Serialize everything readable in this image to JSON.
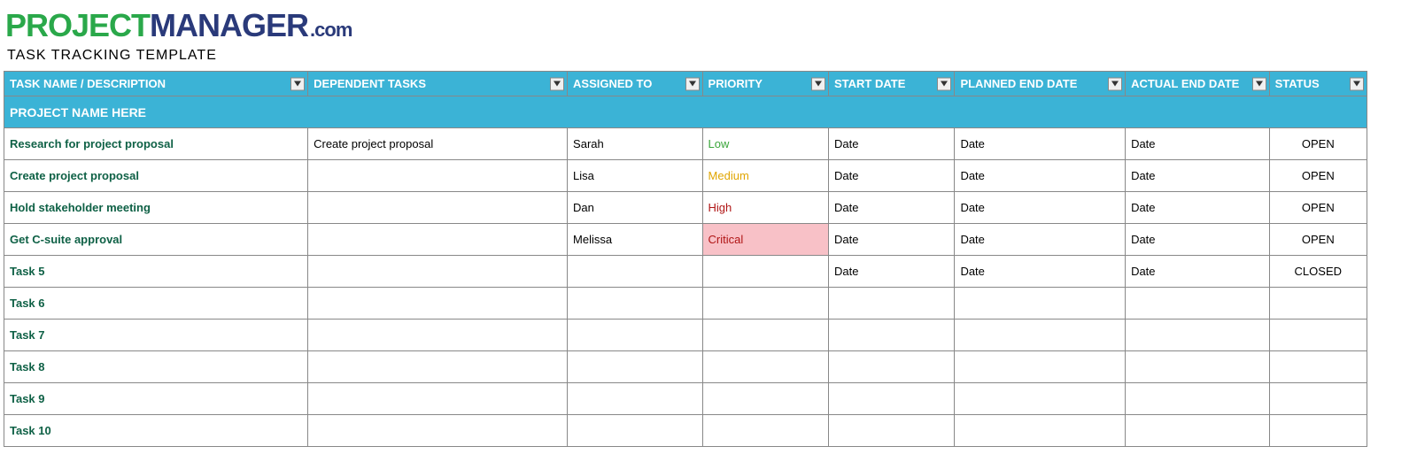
{
  "logo": {
    "part1": "PROJECT",
    "part2": "MANAGER",
    "part3": ".com"
  },
  "subtitle": "TASK TRACKING TEMPLATE",
  "project_name": "PROJECT NAME HERE",
  "columns": [
    "TASK NAME / DESCRIPTION",
    "DEPENDENT TASKS",
    "ASSIGNED TO",
    "PRIORITY",
    "START DATE",
    "PLANNED END DATE",
    "ACTUAL END DATE",
    "STATUS"
  ],
  "priority_classes": {
    "Low": "pri-low",
    "Medium": "pri-medium",
    "High": "pri-high",
    "Critical": "pri-critical"
  },
  "rows": [
    {
      "task": "Research for project proposal",
      "dependent": "Create project proposal",
      "assigned": "Sarah",
      "priority": "Low",
      "start": "Date",
      "planned": "Date",
      "actual": "Date",
      "status": "OPEN"
    },
    {
      "task": "Create project proposal",
      "dependent": "",
      "assigned": "Lisa",
      "priority": "Medium",
      "start": "Date",
      "planned": "Date",
      "actual": "Date",
      "status": "OPEN"
    },
    {
      "task": "Hold stakeholder meeting",
      "dependent": "",
      "assigned": "Dan",
      "priority": "High",
      "start": "Date",
      "planned": "Date",
      "actual": "Date",
      "status": "OPEN"
    },
    {
      "task": "Get C-suite approval",
      "dependent": "",
      "assigned": "Melissa",
      "priority": "Critical",
      "start": "Date",
      "planned": "Date",
      "actual": "Date",
      "status": "OPEN"
    },
    {
      "task": "Task 5",
      "dependent": "",
      "assigned": "",
      "priority": "",
      "start": "Date",
      "planned": "Date",
      "actual": "Date",
      "status": "CLOSED"
    },
    {
      "task": "Task 6",
      "dependent": "",
      "assigned": "",
      "priority": "",
      "start": "",
      "planned": "",
      "actual": "",
      "status": ""
    },
    {
      "task": "Task 7",
      "dependent": "",
      "assigned": "",
      "priority": "",
      "start": "",
      "planned": "",
      "actual": "",
      "status": ""
    },
    {
      "task": "Task 8",
      "dependent": "",
      "assigned": "",
      "priority": "",
      "start": "",
      "planned": "",
      "actual": "",
      "status": ""
    },
    {
      "task": "Task 9",
      "dependent": "",
      "assigned": "",
      "priority": "",
      "start": "",
      "planned": "",
      "actual": "",
      "status": ""
    },
    {
      "task": "Task 10",
      "dependent": "",
      "assigned": "",
      "priority": "",
      "start": "",
      "planned": "",
      "actual": "",
      "status": ""
    }
  ]
}
